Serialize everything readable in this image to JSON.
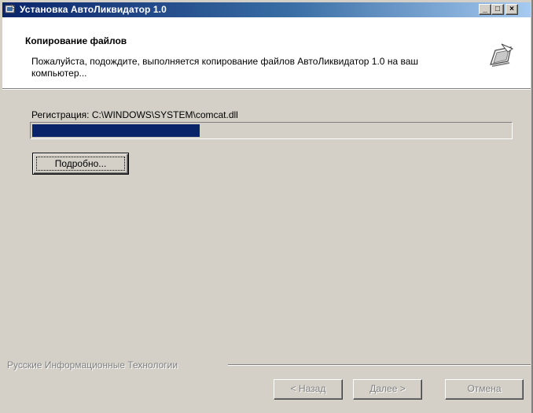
{
  "window": {
    "title": "Установка АвтоЛиквидатор 1.0",
    "controls": {
      "minimize": "_",
      "maximize": "□",
      "close": "×"
    }
  },
  "header": {
    "title": "Копирование файлов",
    "description": "Пожалуйста, подождите, выполняется копирование файлов АвтоЛиквидатор 1.0 на ваш компьютер...",
    "icon": "setup-computer-icon"
  },
  "status": {
    "text": "Регистрация: C:\\WINDOWS\\SYSTEM\\comcat.dll",
    "progress": 0.35
  },
  "buttons": {
    "details": "Подробно...",
    "back": "< Назад",
    "next": "Далее >",
    "cancel": "Отмена"
  },
  "branding": "Русские Информационные Технологии",
  "colors": {
    "titlebar_start": "#0a246a",
    "titlebar_end": "#a6caf0",
    "progress_fill": "#0a246a",
    "face": "#d4d0c8"
  }
}
